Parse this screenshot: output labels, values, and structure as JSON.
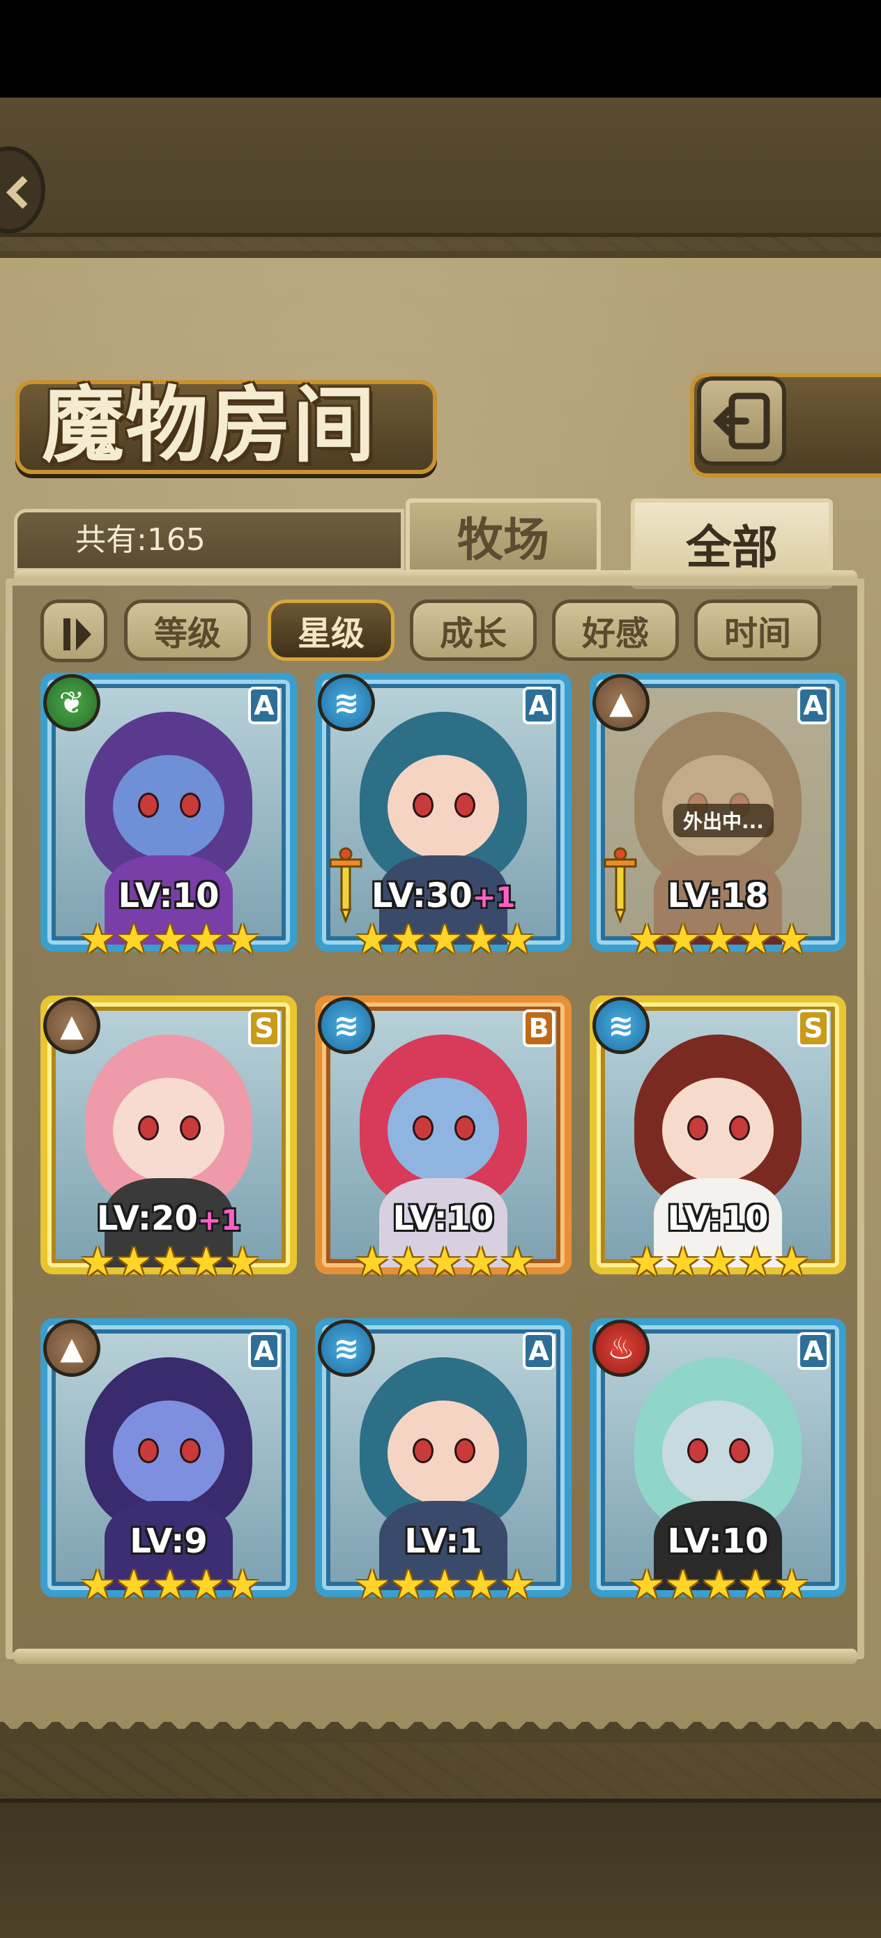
{
  "header": {
    "title": "魔物房间",
    "count_label": "共有:165"
  },
  "tabs": [
    {
      "label": "牧场",
      "active": false
    },
    {
      "label": "全部",
      "active": true
    }
  ],
  "sort": {
    "buttons": [
      {
        "label": "等级",
        "active": false
      },
      {
        "label": "星级",
        "active": true
      },
      {
        "label": "成长",
        "active": false
      },
      {
        "label": "好感",
        "active": false
      },
      {
        "label": "时间",
        "active": false
      }
    ]
  },
  "monsters": [
    {
      "level": "LV:10",
      "bonus": "",
      "rank": "A",
      "element": "nature-icon",
      "stars": "★★★★★",
      "equipped_sword": false,
      "status": "",
      "colors": {
        "hair": "#5a3a8e",
        "skin": "#6f8fd6",
        "body": "#7a3ea8"
      }
    },
    {
      "level": "LV:30",
      "bonus": "+1",
      "rank": "A",
      "element": "water-icon",
      "stars": "★★★★★",
      "equipped_sword": true,
      "status": "",
      "colors": {
        "hair": "#2d6f86",
        "skin": "#f6d4c4",
        "body": "#3a4a6a"
      }
    },
    {
      "level": "LV:18",
      "bonus": "",
      "rank": "A",
      "element": "earth-icon",
      "stars": "★★★★★",
      "equipped_sword": true,
      "status": "外出中...",
      "colors": {
        "hair": "#5e3e2a",
        "skin": "#e9c8b4",
        "body": "#6b2a2a"
      }
    },
    {
      "level": "LV:20",
      "bonus": "+1",
      "rank": "S",
      "element": "earth-icon",
      "stars": "★★★★★",
      "equipped_sword": false,
      "status": "",
      "colors": {
        "hair": "#ee9aa8",
        "skin": "#f7dad0",
        "body": "#3a3a3a"
      }
    },
    {
      "level": "LV:10",
      "bonus": "",
      "rank": "B",
      "element": "water-icon",
      "stars": "★★★★★",
      "equipped_sword": false,
      "status": "",
      "colors": {
        "hair": "#d83a5a",
        "skin": "#8fb4e0",
        "body": "#d8d0e0"
      }
    },
    {
      "level": "LV:10",
      "bonus": "",
      "rank": "S",
      "element": "water-icon",
      "stars": "★★★★★",
      "equipped_sword": false,
      "status": "",
      "colors": {
        "hair": "#7a2a20",
        "skin": "#f6dacb",
        "body": "#f4f2ee"
      }
    },
    {
      "level": "LV:9",
      "bonus": "",
      "rank": "A",
      "element": "earth-icon",
      "stars": "★★★★★",
      "equipped_sword": false,
      "status": "",
      "colors": {
        "hair": "#3a2a6e",
        "skin": "#7e8fe0",
        "body": "#3d2d72"
      }
    },
    {
      "level": "LV:1",
      "bonus": "",
      "rank": "A",
      "element": "water-icon",
      "stars": "★★★★★",
      "equipped_sword": false,
      "status": "",
      "colors": {
        "hair": "#2d6f86",
        "skin": "#f6d4c4",
        "body": "#3a4a6a"
      }
    },
    {
      "level": "LV:10",
      "bonus": "",
      "rank": "A",
      "element": "fire-icon",
      "stars": "★★★★★",
      "equipped_sword": false,
      "status": "",
      "colors": {
        "hair": "#8fd6c8",
        "skin": "#c7dae0",
        "body": "#2a2a2a"
      }
    }
  ]
}
